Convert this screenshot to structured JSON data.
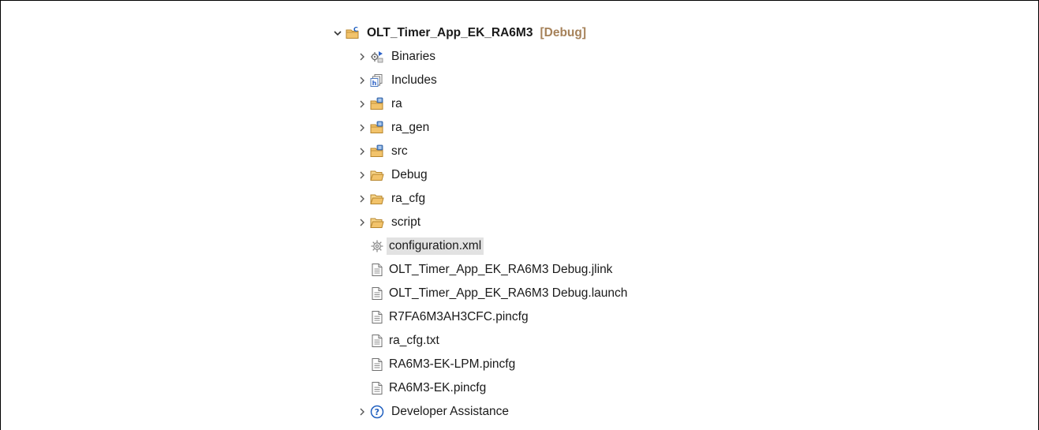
{
  "project": {
    "name": "OLT_Timer_App_EK_RA6M3",
    "decoration": "[Debug]"
  },
  "items": [
    {
      "label": "Binaries",
      "icon": "binaries-icon",
      "expandable": true
    },
    {
      "label": "Includes",
      "icon": "includes-icon",
      "expandable": true
    },
    {
      "label": "ra",
      "icon": "source-folder-icon",
      "expandable": true
    },
    {
      "label": "ra_gen",
      "icon": "source-folder-icon",
      "expandable": true
    },
    {
      "label": "src",
      "icon": "source-folder-icon",
      "expandable": true
    },
    {
      "label": "Debug",
      "icon": "folder-icon",
      "expandable": true
    },
    {
      "label": "ra_cfg",
      "icon": "folder-icon",
      "expandable": true
    },
    {
      "label": "script",
      "icon": "folder-icon",
      "expandable": true
    },
    {
      "label": "configuration.xml",
      "icon": "gear-icon",
      "expandable": false,
      "selected": true
    },
    {
      "label": "OLT_Timer_App_EK_RA6M3 Debug.jlink",
      "icon": "file-icon",
      "expandable": false
    },
    {
      "label": "OLT_Timer_App_EK_RA6M3 Debug.launch",
      "icon": "file-icon",
      "expandable": false
    },
    {
      "label": "R7FA6M3AH3CFC.pincfg",
      "icon": "file-icon",
      "expandable": false
    },
    {
      "label": "ra_cfg.txt",
      "icon": "file-icon",
      "expandable": false
    },
    {
      "label": "RA6M3-EK-LPM.pincfg",
      "icon": "file-icon",
      "expandable": false
    },
    {
      "label": "RA6M3-EK.pincfg",
      "icon": "file-icon",
      "expandable": false
    },
    {
      "label": "Developer Assistance",
      "icon": "help-icon",
      "expandable": true
    }
  ],
  "colors": {
    "selection": "#e2e2e2",
    "decoration": "#a6825a",
    "folder": "#f2c36b",
    "source_folder_badge": "#5b8fd1",
    "help": "#1f5fbf"
  }
}
